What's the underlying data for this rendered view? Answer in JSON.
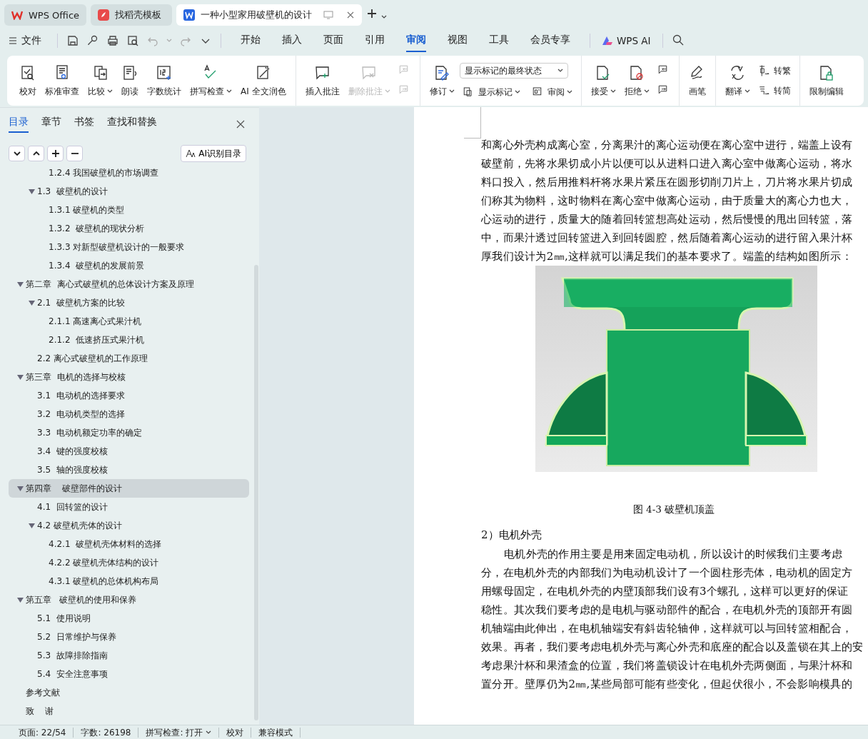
{
  "window_tabs": [
    {
      "label": "WPS Office",
      "selected": false,
      "kind": "home"
    },
    {
      "label": "找稻壳模板",
      "selected": false,
      "kind": "template"
    },
    {
      "label": "一种小型家用破壁机的设计",
      "selected": true,
      "kind": "document"
    }
  ],
  "menu": {
    "file": "文件",
    "tabs": [
      {
        "label": "开始",
        "selected": false
      },
      {
        "label": "插入",
        "selected": false
      },
      {
        "label": "页面",
        "selected": false
      },
      {
        "label": "引用",
        "selected": false
      },
      {
        "label": "审阅",
        "selected": true
      },
      {
        "label": "视图",
        "selected": false
      },
      {
        "label": "工具",
        "selected": false
      },
      {
        "label": "会员专享",
        "selected": false
      }
    ],
    "ai": "WPS AI"
  },
  "ribbon": {
    "groups": [
      {
        "items": [
          {
            "kind": "large",
            "label": "校对",
            "dropdown": false,
            "disabled": false
          },
          {
            "kind": "large",
            "label": "标准审查",
            "dropdown": false,
            "disabled": false
          },
          {
            "kind": "large",
            "label": "比较",
            "dropdown": true,
            "disabled": false
          },
          {
            "kind": "large",
            "label": "朗读",
            "dropdown": false,
            "disabled": false
          },
          {
            "kind": "large",
            "label": "字数统计",
            "dropdown": false,
            "disabled": false
          },
          {
            "kind": "large",
            "label": "拼写检查",
            "dropdown": true,
            "disabled": false
          },
          {
            "kind": "large",
            "label": "AI 全文润色",
            "dropdown": false,
            "disabled": false
          }
        ]
      },
      {
        "items": [
          {
            "kind": "large",
            "label": "插入批注",
            "dropdown": false,
            "disabled": false
          },
          {
            "kind": "large",
            "label": "删除批注",
            "dropdown": true,
            "disabled": true
          },
          {
            "kind": "pair",
            "buttons": [
              {
                "dropdown": false,
                "disabled": true
              },
              {
                "dropdown": false,
                "disabled": true
              }
            ]
          }
        ]
      },
      {
        "items": [
          {
            "kind": "large",
            "label": "修订",
            "dropdown": true,
            "disabled": false
          },
          {
            "kind": "select",
            "value": "显示标记的最终状态",
            "buttons": [
              {
                "label": "显示标记",
                "dropdown": true,
                "disabled": false
              },
              {
                "label": "审阅",
                "dropdown": true,
                "disabled": false
              }
            ]
          }
        ]
      },
      {
        "items": [
          {
            "kind": "large",
            "label": "接受",
            "dropdown": true,
            "disabled": false
          },
          {
            "kind": "large",
            "label": "拒绝",
            "dropdown": true,
            "disabled": false
          },
          {
            "kind": "pair",
            "buttons": [
              {
                "dropdown": false,
                "disabled": false
              },
              {
                "dropdown": false,
                "disabled": false
              }
            ]
          }
        ]
      },
      {
        "items": [
          {
            "kind": "large",
            "label": "画笔",
            "dropdown": false,
            "disabled": false
          }
        ]
      },
      {
        "items": [
          {
            "kind": "large",
            "label": "翻译",
            "dropdown": true,
            "disabled": false
          },
          {
            "kind": "pair",
            "buttons": [
              {
                "label": "转繁",
                "dropdown": false,
                "disabled": false
              },
              {
                "label": "转简",
                "dropdown": false,
                "disabled": false
              }
            ]
          }
        ]
      },
      {
        "items": [
          {
            "kind": "large",
            "label": "限制编辑",
            "dropdown": false,
            "disabled": false
          }
        ]
      }
    ]
  },
  "nav": {
    "tabs": [
      {
        "label": "目录",
        "selected": true
      },
      {
        "label": "章节",
        "selected": false
      },
      {
        "label": "书签",
        "selected": false
      },
      {
        "label": "查找和替换",
        "selected": false
      }
    ],
    "ai_button": "AI识别目录",
    "toc": [
      {
        "children": [
          {
            "children": [
              {
                "label": "1.2.4 我国破壁机的市场调查",
                "selected": false
              }
            ]
          },
          {
            "label": "1.3  破壁机的设计",
            "selected": false,
            "expanded": true,
            "children": [
              {
                "label": "1.3.1 破壁机的类型",
                "selected": false
              },
              {
                "label": "1.3.2  破壁机的现状分析",
                "selected": false
              },
              {
                "label": "1.3.3 对新型破壁机设计的一般要求",
                "selected": false
              },
              {
                "label": "1.3.4  破壁机的发展前景",
                "selected": false
              }
            ]
          }
        ]
      },
      {
        "label": "第二章  离心式破壁机的总体设计方案及原理",
        "selected": false,
        "expanded": true,
        "children": [
          {
            "label": "2.1  破壁机方案的比较",
            "selected": false,
            "expanded": true,
            "children": [
              {
                "label": "2.1.1 高速离心式果汁机",
                "selected": false
              },
              {
                "label": "2.1.2  低速挤压式果汁机",
                "selected": false
              }
            ]
          },
          {
            "label": "2.2 离心式破壁机的工作原理",
            "selected": false
          }
        ]
      },
      {
        "label": "第三章  电机的选择与校核",
        "selected": false,
        "expanded": true,
        "children": [
          {
            "label": "3.1  电动机的选择要求",
            "selected": false
          },
          {
            "label": "3.2  电动机类型的选择",
            "selected": false
          },
          {
            "label": "3.3  电动机额定功率的确定",
            "selected": false
          },
          {
            "label": "3.4  键的强度校核",
            "selected": false
          },
          {
            "label": "3.5  轴的强度校核",
            "selected": false
          }
        ]
      },
      {
        "label": "第四章    破壁部件的设计",
        "selected": true,
        "expanded": true,
        "children": [
          {
            "label": "4.1  回转篮的设计",
            "selected": false
          },
          {
            "label": "4.2 破壁机壳体的设计",
            "selected": false,
            "expanded": true,
            "children": [
              {
                "label": "4.2.1  破壁机壳体材料的选择",
                "selected": false
              },
              {
                "label": "4.2.2 破壁机壳体结构的设计",
                "selected": false
              },
              {
                "label": "4.3.1 破壁机的总体机构布局",
                "selected": false
              }
            ]
          }
        ]
      },
      {
        "label": "第五章   破壁机的使用和保养",
        "selected": false,
        "expanded": true,
        "children": [
          {
            "label": "5.1  使用说明",
            "selected": false
          },
          {
            "label": "5.2  日常维护与保养",
            "selected": false
          },
          {
            "label": "5.3  故障排除指南",
            "selected": false
          },
          {
            "label": "5.4  安全注意事项",
            "selected": false
          }
        ]
      },
      {
        "label": "参考文献",
        "selected": false
      },
      {
        "label": "致    谢",
        "selected": false
      }
    ]
  },
  "document": {
    "blocks": [
      {
        "kind": "lines",
        "indent_first": false,
        "lines": [
          "和离心外壳构成离心室，分离果汁的离心运动便在离心室中进行，端盖上设有",
          "破壁前，先将水果切成小片以便可以从进料口进入离心室中做离心运动，将水",
          "料口投入，然后用推料杆将水果片紧压在圆形切削刀片上，刀片将水果片切成",
          "们称其为物料，这时物料在离心室中做离心运动，由于质量大的离心力也大，",
          "心运动的进行，质量大的随着回转篮想高处运动，然后慢慢的甩出回转篮，落",
          "中，而果汁透过回转篮进入到回转圆腔，然后随着离心运动的进行留入果汁杯",
          "厚我们设计为2㎜,这样就可以满足我们的基本要求了。端盖的结构如图所示："
        ]
      },
      {
        "kind": "figure",
        "caption": "图 4-3 破壁机顶盖"
      },
      {
        "kind": "heading",
        "text": "2）电机外壳"
      },
      {
        "kind": "lines",
        "indent_first": true,
        "lines": [
          "电机外壳的作用主要是用来固定电动机，所以设计的时候我们主要考虑",
          "分，在电机外壳的内部我们为电动机设计了一个圆柱形壳体，电动机的固定方",
          "用螺母固定，在电机外壳的内壁顶部我们设有3个螺孔，这样可以更好的保证",
          "稳性。其次我们要考虑的是电机与驱动部件的配合，在电机外壳的顶部开有圆",
          "机轴端由此伸出，在电机轴端安有斜齿轮轴伸，这样就可以与回转篮相配合，",
          "效果。再者，我们要考虑电机外壳与离心外壳和底座的配合以及盖锁在其上的安",
          "考虑果汁杯和果渣盒的位置，我们将盖锁设计在电机外壳两侧面，与果汁杯和",
          "置分开。壁厚仍为2㎜,某些局部可能有些变化，但起伏很小，不会影响模具的"
        ]
      }
    ]
  },
  "status_bar": [
    {
      "kind": "text",
      "label": "页面: 22/54"
    },
    {
      "kind": "text",
      "label": "字数: 26198"
    },
    {
      "kind": "dropdown",
      "label": "拼写检查: 打开"
    },
    {
      "kind": "button",
      "label": "校对"
    },
    {
      "kind": "text",
      "label": "兼容模式"
    }
  ]
}
